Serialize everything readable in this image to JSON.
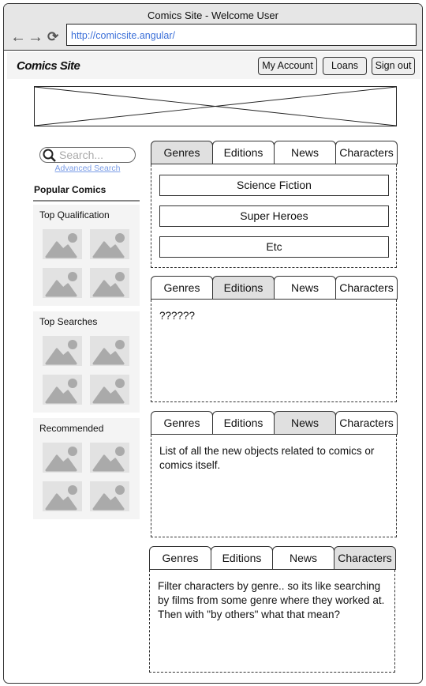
{
  "browser": {
    "title": "Comics Site - Welcome User",
    "url": "http://comicsite.angular/",
    "icons": [
      "back-arrow-icon",
      "forward-arrow-icon",
      "reload-icon"
    ]
  },
  "header": {
    "logo": "Comics Site",
    "buttons": [
      "My Account",
      "Loans",
      "Sign out"
    ]
  },
  "sidebar": {
    "search_placeholder": "Search...",
    "advanced_search": "Advanced Search",
    "popular_title": "Popular Comics",
    "sections": [
      {
        "label": "Top Qualification"
      },
      {
        "label": "Top Searches"
      },
      {
        "label": "Recommended"
      }
    ]
  },
  "tabs": [
    "Genres",
    "Editions",
    "News",
    "Characters"
  ],
  "panels": [
    {
      "active": "Genres",
      "genres": [
        "Science Fiction",
        "Super Heroes",
        "Etc"
      ]
    },
    {
      "active": "Editions",
      "text": "??????"
    },
    {
      "active": "News",
      "text": "List of all the new objects related to comics or comics itself."
    },
    {
      "active": "Characters",
      "text": "Filter characters by genre.. so its like searching by films from some genre where they worked at. Then with \"by others\" what that mean?"
    }
  ]
}
